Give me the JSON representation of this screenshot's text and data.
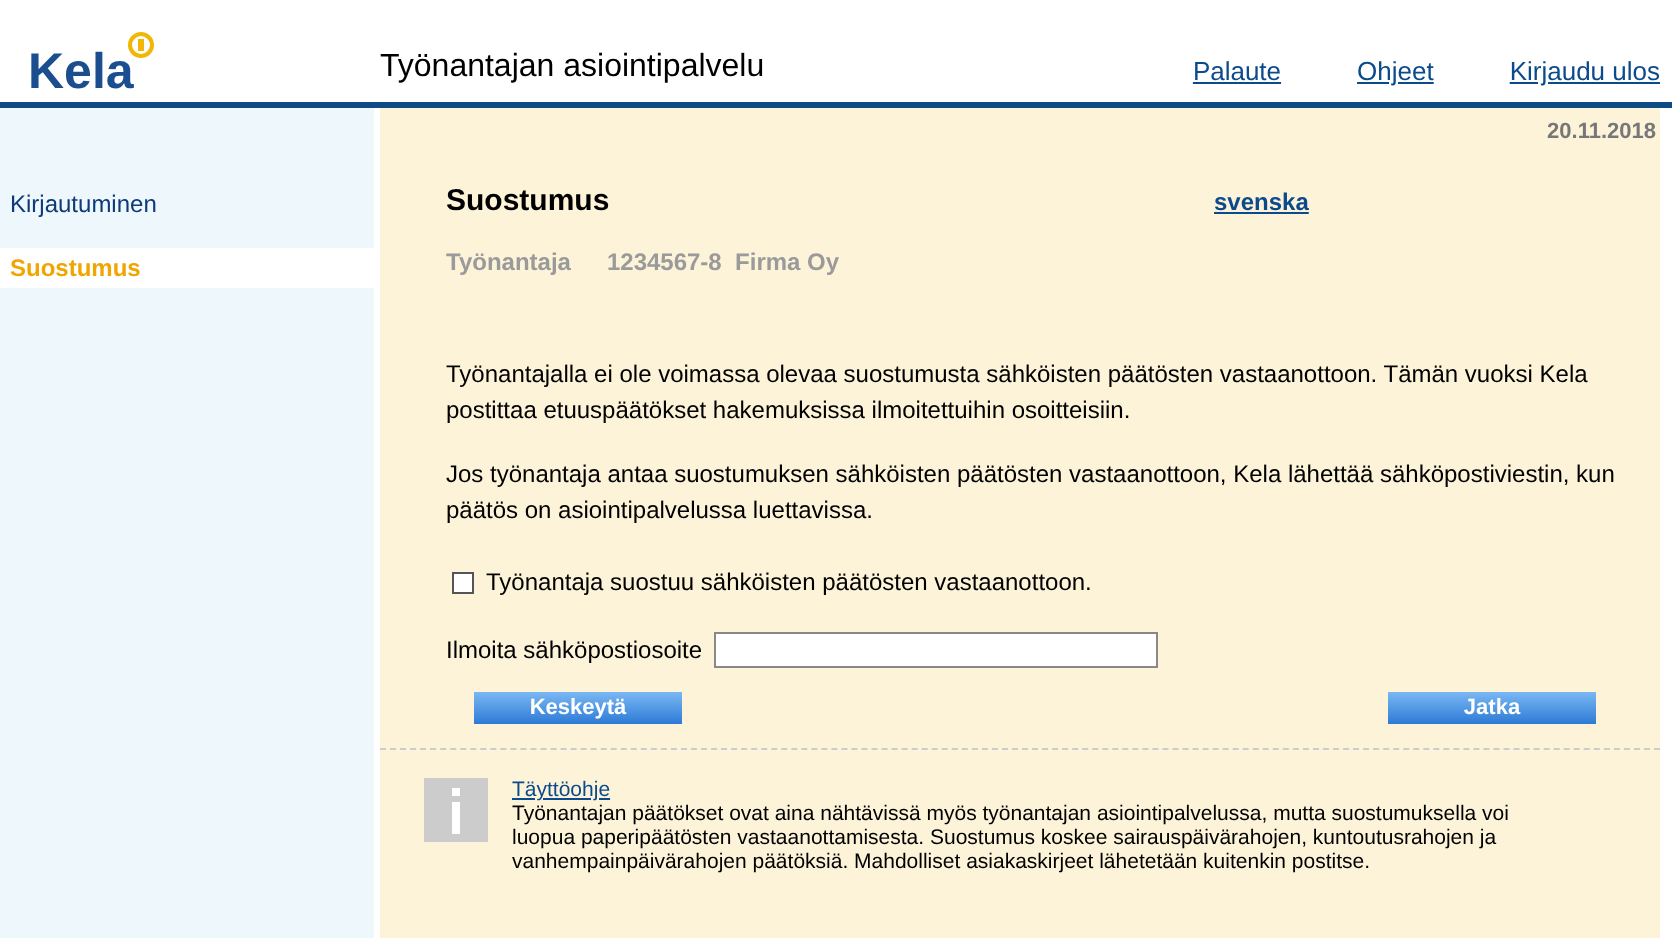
{
  "header": {
    "logo": "Kela",
    "service_title": "Työnantajan asiointipalvelu",
    "links": [
      "Palaute",
      "Ohjeet",
      "Kirjaudu ulos"
    ]
  },
  "date": "20.11.2018",
  "sidebar": {
    "items": [
      {
        "label": "Kirjautuminen",
        "selected": false
      },
      {
        "label": "Suostumus",
        "selected": true
      }
    ]
  },
  "page": {
    "title": "Suostumus",
    "language_link": "svenska",
    "employer_label": "Työnantaja",
    "employer_value": "1234567-8  Firma Oy"
  },
  "paragraphs": [
    "Työnantajalla ei ole voimassa olevaa suostumusta sähköisten päätösten vastaanottoon. Tämän vuoksi Kela postittaa etuuspäätökset hakemuksissa ilmoitettuihin osoitteisiin.",
    "Jos työnantaja antaa suostumuksen sähköisten päätösten vastaanottoon, Kela lähettää sähköpostiviestin, kun päätös on asiointipalvelussa luettavissa."
  ],
  "consent": {
    "label": "Työnantaja suostuu sähköisten päätösten vastaanottoon.",
    "checked": false
  },
  "email": {
    "label": "Ilmoita sähköpostiosoite"
  },
  "buttons": [
    "Keskeytä",
    "Jatka"
  ],
  "help": {
    "title": "Täyttöohje",
    "text": "Työnantajan päätökset ovat aina nähtävissä myös työnantajan asiointipalvelussa, mutta suostumuksella voi luopua paperipäätösten vastaanottamisesta. Suostumus koskee sairauspäivärahojen, kuntoutusrahojen ja vanhempainpäivärahojen päätöksiä. Mahdolliset asiakaskirjeet lähetetään kuitenkin postitse."
  }
}
